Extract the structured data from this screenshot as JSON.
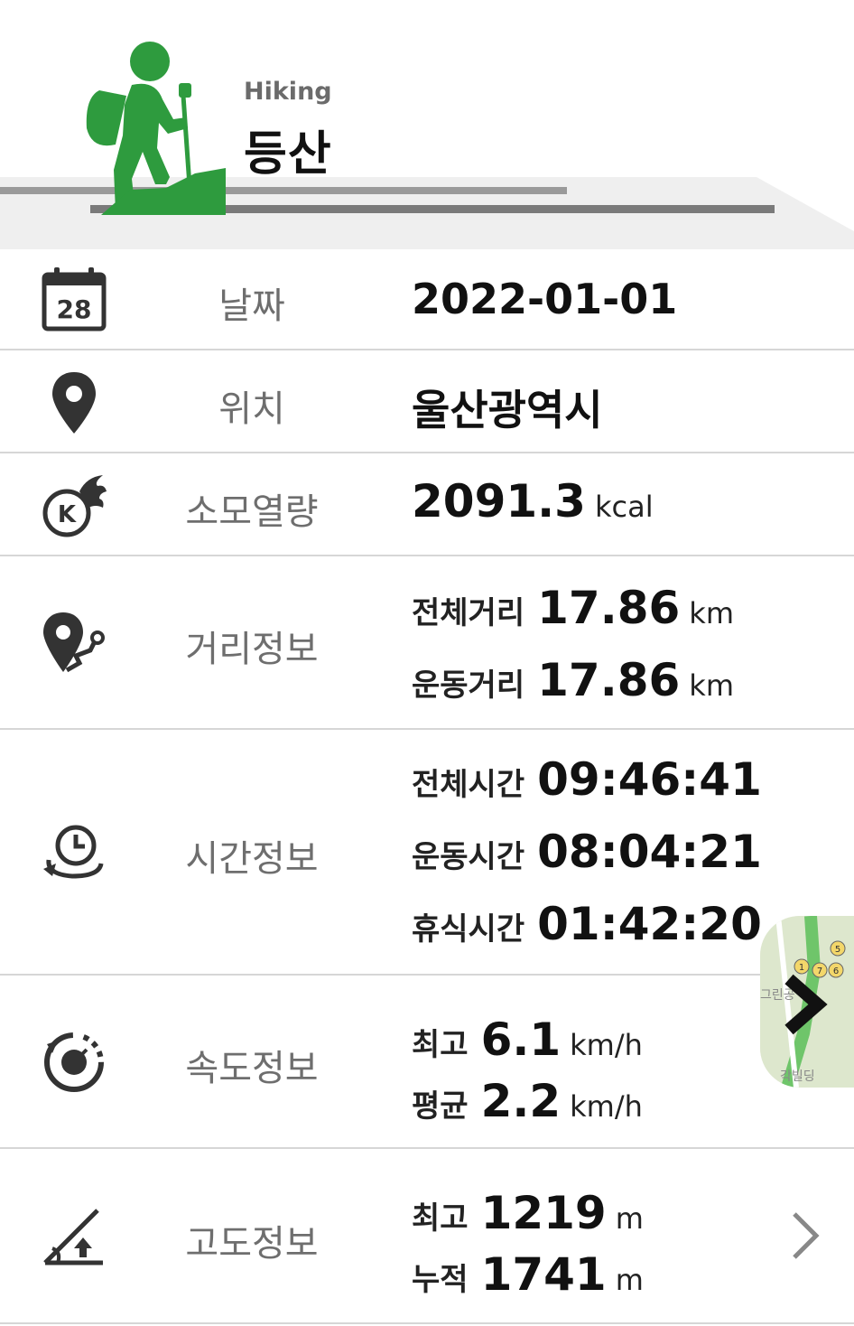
{
  "header": {
    "subtitle": "Hiking",
    "title": "등산",
    "icon": "hiker-icon",
    "accent_color": "#2e9b3e"
  },
  "rows": {
    "date": {
      "label": "날짜",
      "value": "2022-01-01",
      "icon": "calendar-icon",
      "icon_text": "28"
    },
    "location": {
      "label": "위치",
      "value": "울산광역시",
      "icon": "location-pin-icon"
    },
    "calories": {
      "label": "소모열량",
      "value": "2091.3",
      "unit": "kcal",
      "icon": "calorie-fire-icon",
      "icon_text": "K"
    },
    "distance": {
      "label": "거리정보",
      "icon": "distance-route-icon",
      "total_label": "전체거리",
      "total_value": "17.86",
      "total_unit": "km",
      "exercise_label": "운동거리",
      "exercise_value": "17.86",
      "exercise_unit": "km"
    },
    "time": {
      "label": "시간정보",
      "icon": "clock-cycle-icon",
      "total_label": "전체시간",
      "total_value": "09:46:41",
      "exercise_label": "운동시간",
      "exercise_value": "08:04:21",
      "rest_label": "휴식시간",
      "rest_value": "01:42:20"
    },
    "speed": {
      "label": "속도정보",
      "icon": "speedometer-icon",
      "max_label": "최고",
      "max_value": "6.1",
      "max_unit": "km/h",
      "avg_label": "평균",
      "avg_value": "2.2",
      "avg_unit": "km/h"
    },
    "altitude": {
      "label": "고도정보",
      "icon": "altitude-slope-icon",
      "max_label": "최고",
      "max_value": "1219",
      "max_unit": "m",
      "cumulative_label": "누적",
      "cumulative_value": "1741",
      "cumulative_unit": "m"
    }
  },
  "map_thumbnail": {
    "icon": "chevron-right-icon",
    "text_top": "그린공",
    "text_bottom": "각빌딩",
    "badges": [
      "1",
      "7",
      "6",
      "5"
    ]
  }
}
